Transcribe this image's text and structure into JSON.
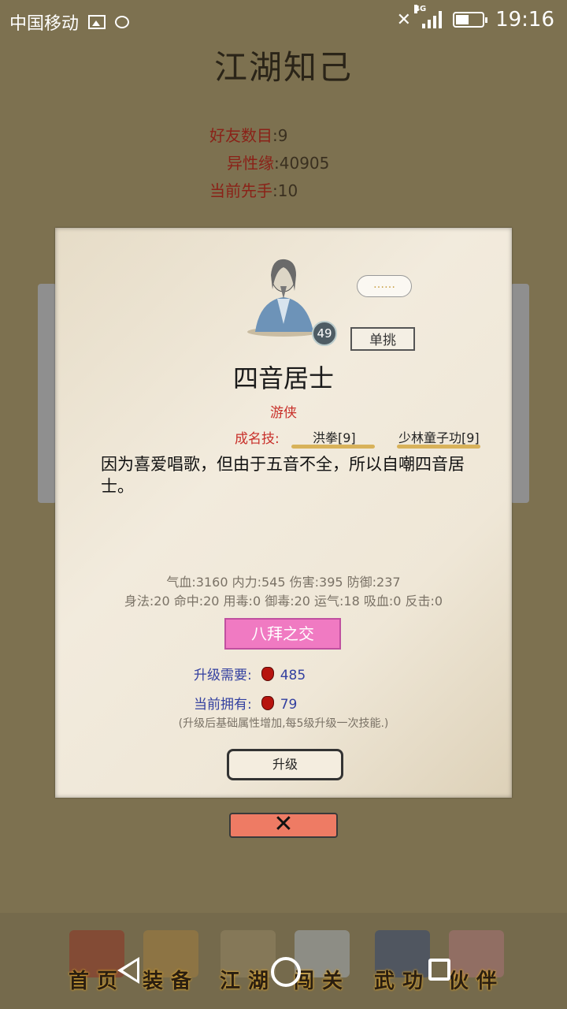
{
  "status_bar": {
    "carrier": "中国移动",
    "network": "4G",
    "time": "19:16",
    "icons": [
      "image-icon",
      "chat-icon",
      "mute-icon",
      "signal-icon",
      "battery-icon"
    ]
  },
  "page": {
    "title": "江湖知己"
  },
  "summary": [
    {
      "key": "好友数目",
      "value": ":9"
    },
    {
      "key": "异性缘",
      "value": ":40905"
    },
    {
      "key": "当前先手",
      "value": ":10"
    }
  ],
  "npc": {
    "level": "49",
    "bubble": "……",
    "duel_label": "单挑",
    "name": "四音居士",
    "class": "游侠",
    "skills_label": "成名技:",
    "skills": [
      "洪拳[9]",
      "少林童子功[9]"
    ],
    "description": "因为喜爱唱歌，但由于五音不全，所以自嘲四音居士。",
    "attributes_line1": "气血:3160  内力:545  伤害:395  防御:237",
    "attributes_line2": "身法:20  命中:20  用毒:0  御毒:20  运气:18  吸血:0  反击:0",
    "pact_label": "八拜之交",
    "upgrade_need_label": "升级需要:",
    "upgrade_need_value": "485",
    "current_have_label": "当前拥有:",
    "current_have_value": "79",
    "hint": "(升级后基础属性增加,每5级升级一次技能.)",
    "upgrade_label": "升级"
  },
  "close_label": "✕",
  "tabs": [
    {
      "label": "首页",
      "icon": "home-building-icon"
    },
    {
      "label": "装备",
      "icon": "armor-icon"
    },
    {
      "label": "江湖",
      "icon": "scroll-map-icon"
    },
    {
      "label": "闯关",
      "icon": "crossed-swords-icon"
    },
    {
      "label": "武功",
      "icon": "martial-book-icon"
    },
    {
      "label": "伙伴",
      "icon": "companions-icon"
    }
  ],
  "colors": {
    "accent_red": "#c8302a",
    "pact_pink": "#f07ac2",
    "close_salmon": "#ee7b64"
  }
}
